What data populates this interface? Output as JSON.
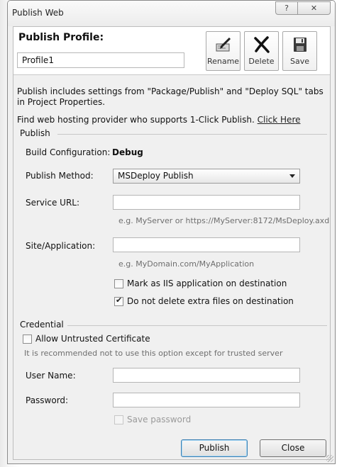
{
  "window": {
    "title": "Publish Web",
    "help_glyph": "?",
    "close_glyph": "✕"
  },
  "profile": {
    "heading": "Publish Profile:",
    "value": "Profile1",
    "buttons": {
      "rename": "Rename",
      "delete": "Delete",
      "save": "Save"
    }
  },
  "info": {
    "line1": "Publish includes settings from \"Package/Publish\" and \"Deploy SQL\" tabs in Project Properties.",
    "line2_prefix": "Find web hosting provider who supports 1-Click Publish.",
    "line2_link": "Click Here"
  },
  "publish_group": {
    "title": "Publish",
    "build_config_label": "Build Configuration:",
    "build_config_value": "Debug",
    "method_label": "Publish Method:",
    "method_value": "MSDeploy Publish",
    "service_url_label": "Service URL:",
    "service_url_value": "",
    "service_url_hint": "e.g. MyServer or https://MyServer:8172/MsDeploy.axd",
    "site_label": "Site/Application:",
    "site_value": "",
    "site_hint": "e.g. MyDomain.com/MyApplication",
    "mark_iis_label": "Mark as IIS application on destination",
    "mark_iis_checked": false,
    "do_not_delete_label": "Do not delete extra files on destination",
    "do_not_delete_checked": true
  },
  "credential_group": {
    "title": "Credential",
    "allow_untrusted_label": "Allow Untrusted Certificate",
    "allow_untrusted_checked": false,
    "untrusted_note": "It is recommended not to use this option except for trusted server",
    "username_label": "User Name:",
    "username_value": "",
    "password_label": "Password:",
    "password_value": "",
    "save_password_label": "Save password",
    "save_password_checked": false
  },
  "footer": {
    "publish": "Publish",
    "close": "Close"
  },
  "colors": {
    "dialog_bg": "#f0f0f0",
    "panel_bg": "#ffffff",
    "hint_text": "#6e6e6e",
    "default_button_border": "#3c7fb1"
  },
  "icons": {
    "rename": "rename-pencil-icon",
    "delete": "delete-x-icon",
    "save": "floppy-disk-icon"
  }
}
